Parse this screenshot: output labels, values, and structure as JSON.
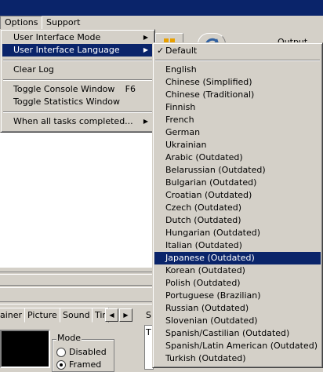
{
  "menubar": {
    "options": "Options",
    "support": "Support"
  },
  "background": {
    "output_label": "Output Fold"
  },
  "tabs": [
    "ainer",
    "Picture",
    "Sound",
    "Tir"
  ],
  "tab_arrows": {
    "left": "◀",
    "right": "▶"
  },
  "mode_group": {
    "title": "Mode",
    "disabled_label": "Disabled",
    "framed_label": "Framed"
  },
  "side_letter": "S",
  "side_text": "T",
  "options_menu": {
    "ui_mode": "User Interface Mode",
    "ui_language": "User Interface Language",
    "clear_log": "Clear Log",
    "toggle_console": "Toggle Console Window",
    "toggle_console_shortcut": "F6",
    "toggle_stats": "Toggle Statistics Window",
    "when_all_done": "When all tasks completed..."
  },
  "language_menu": {
    "default": "Default",
    "default_checked": true,
    "selected": "Japanese (Outdated)",
    "languages": [
      "English",
      "Chinese (Simplified)",
      "Chinese (Traditional)",
      "Finnish",
      "French",
      "German",
      "Ukrainian",
      "Arabic (Outdated)",
      "Belarussian (Outdated)",
      "Bulgarian (Outdated)",
      "Croatian (Outdated)",
      "Czech (Outdated)",
      "Dutch (Outdated)",
      "Hungarian (Outdated)",
      "Italian (Outdated)",
      "Japanese (Outdated)",
      "Korean (Outdated)",
      "Polish (Outdated)",
      "Portuguese (Brazilian)",
      "Russian (Outdated)",
      "Slovenian (Outdated)",
      "Spanish/Castilian (Outdated)",
      "Spanish/Latin American (Outdated)",
      "Turkish (Outdated)"
    ]
  },
  "icons": {
    "submenu_arrow": "arrow-right-icon",
    "check": "check-icon"
  }
}
